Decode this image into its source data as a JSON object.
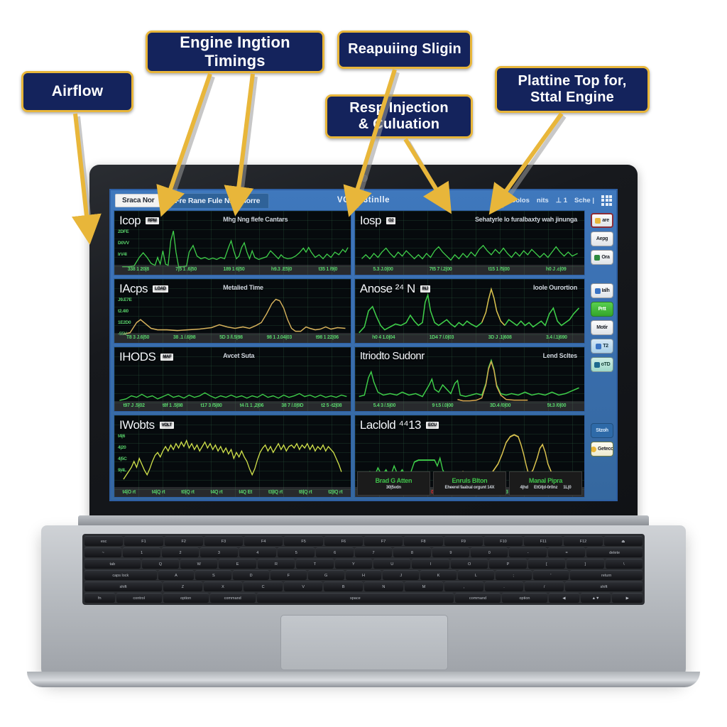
{
  "callouts": [
    {
      "id": "airflow",
      "label": "Airflow"
    },
    {
      "id": "ignition",
      "label": "Engine Ingtion Timings"
    },
    {
      "id": "sampling",
      "label": "Reapuiing Sligin"
    },
    {
      "id": "injection",
      "label": "Resp Injection\n& Culuation"
    },
    {
      "id": "platform",
      "label": "Plattine Top for,\nSttal Engine"
    }
  ],
  "app": {
    "titlebar": {
      "save_button": "Sraca Nor",
      "tab": "Fre Rane Fule Nling  Iorre",
      "title": "VCD8  3tinlle",
      "right_items": [
        "Colos",
        "nits",
        "⊥ 1",
        "Sche |"
      ],
      "grid_icon": "grid-icon"
    },
    "left_panels": [
      {
        "label": "Icop",
        "badge": "RPM",
        "header": "Mhg Nng flefe Cantars",
        "yticks": [
          "2DFE",
          "D0VV",
          "IrV4l"
        ],
        "xticks": [
          "338 1 20|8",
          "7|5 1 .6|50",
          "189 1 6|50",
          "h9.3 .E5|0",
          "t35 1 /9|0"
        ]
      },
      {
        "label": "IAcps",
        "badge": "LOAD",
        "header": "Metalied Time",
        "yticks": [
          "J9.E7E",
          "t2.4l0",
          "1E2D0",
          "-55V"
        ],
        "xticks": [
          "T8 3 J.6|50",
          "38 .1 /.6|98",
          "5D 3 /l.5|98",
          "98 1 J.04|03",
          "t98 1 22|06"
        ]
      },
      {
        "label": "IHODS",
        "badge": "MAF",
        "header": "Avcet Suta",
        "yticks": [],
        "xticks": [
          "t97 J .5|02",
          "t8f 1 .5|98",
          "t17 3 /5|80",
          "t4 /1 1 ,2|06",
          "38 7 /.0|9D",
          "t2 5 -t2|08"
        ]
      },
      {
        "label": "IWobts",
        "badge": "VOLT",
        "header": "",
        "yticks": [
          "t4|6",
          "4|20",
          "4|5C",
          "9|4L"
        ],
        "xticks": [
          "t4|O rt",
          "t4|Q rt",
          "t0|Q rt",
          "t4Q rt",
          "t4Q Et",
          "t3|IQ rt",
          "t8|Q rt",
          "t2|IQ rt"
        ]
      }
    ],
    "right_panels": [
      {
        "label": "Iosp",
        "badge": "O2",
        "header": "Sehatyrle lo furalbaxty wah jinunga",
        "yticks": [],
        "xticks": [
          "5.3 J.0|00",
          "7t5 7 /.2|00",
          "t15 1 /5|00",
          "h0 J .c|09"
        ]
      },
      {
        "label": "Anose  ²⁴ N",
        "badge": "INJ",
        "header": "Ioole Ourortion",
        "yticks": [],
        "xticks": [
          "h0 4 1.0|04",
          "1D4 7 /.0|03",
          "3D J .1|608",
          "3.4 /.1|690"
        ]
      },
      {
        "label": "Itriodto Sudonr",
        "badge": "",
        "header": "Lend Scltes",
        "yticks": [],
        "xticks": [
          "5.4 3 /.5|00",
          "9 t.5 /.0|00",
          "3D.4 /0|00",
          "5t.3 /0|00"
        ]
      },
      {
        "label": "Laclold   ⁴⁴13",
        "badge": "ECU",
        "header": "",
        "yticks": [],
        "xticks": [
          "t",
          "2",
          "4",
          "5",
          "1",
          "4",
          "3",
          "2",
          "9",
          "t"
        ],
        "xtick_red_index": 3,
        "xtick_red": "0.0.0",
        "status_boxes": [
          {
            "title": "Brad G Atten",
            "values": [
              "30|5vdn"
            ]
          },
          {
            "title": "Enruls Blton",
            "values": [
              "Eheerel  faalxal  orgunt 14X"
            ]
          },
          {
            "title": "Manal Pipra",
            "values": [
              "4|hd",
              "EtGt|d-0r0nz",
              "1L|0"
            ]
          }
        ]
      }
    ],
    "sidebar": [
      {
        "name": "settings",
        "label": "are",
        "style": "sb-light sb-sel",
        "dot": "#e8b63a"
      },
      {
        "name": "replay",
        "label": "Aepg",
        "style": "sb-light",
        "dot": ""
      },
      {
        "name": "chart",
        "label": "Ora",
        "style": "sb-light",
        "dot": "#2d8a3e"
      },
      {
        "name": "spacer",
        "label": "",
        "style": "sb-spacer",
        "dot": ""
      },
      {
        "name": "windows",
        "label": "Ialh",
        "style": "sb-light",
        "dot": "#3b74c4"
      },
      {
        "name": "print",
        "label": "Prtt",
        "style": "sb-green",
        "dot": ""
      },
      {
        "name": "monitor",
        "label": "Motir",
        "style": "sb-light",
        "dot": ""
      },
      {
        "name": "export",
        "label": "T2",
        "style": "sb-blue",
        "dot": "#3b74c4"
      },
      {
        "name": "tools",
        "label": "oTD",
        "style": "sb-teal",
        "dot": "#1d6a8e"
      },
      {
        "name": "status",
        "label": "Stzoh",
        "style": "sb-dark",
        "dot": ""
      },
      {
        "name": "alert",
        "label": "Geteco",
        "style": "sb-yellow",
        "dot": "#e8b63a"
      }
    ]
  },
  "keyboard": {
    "rows": [
      [
        "esc",
        "F1",
        "F2",
        "F3",
        "F4",
        "F5",
        "F6",
        "F7",
        "F8",
        "F9",
        "F10",
        "F11",
        "F12",
        "⏏"
      ],
      [
        "~",
        "1",
        "2",
        "3",
        "4",
        "5",
        "6",
        "7",
        "8",
        "9",
        "0",
        "-",
        "=",
        "delete"
      ],
      [
        "tab",
        "Q",
        "W",
        "E",
        "R",
        "T",
        "Y",
        "U",
        "I",
        "O",
        "P",
        "[",
        "]",
        "\\"
      ],
      [
        "caps lock",
        "A",
        "S",
        "D",
        "F",
        "G",
        "H",
        "J",
        "K",
        "L",
        ";",
        "'",
        "return"
      ],
      [
        "shift",
        "Z",
        "X",
        "C",
        "V",
        "B",
        "N",
        "M",
        ",",
        ".",
        "/",
        "shift"
      ],
      [
        "fn",
        "control",
        "option",
        "command",
        "space",
        "command",
        "option",
        "◀",
        "▲▼",
        "▶"
      ]
    ]
  }
}
